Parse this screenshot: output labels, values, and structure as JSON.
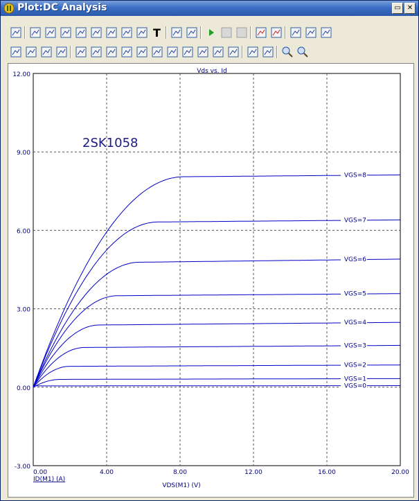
{
  "window": {
    "title": "Plot:DC Analysis"
  },
  "title_buttons": {
    "restore": "▭",
    "close": "✕"
  },
  "toolbar1": [
    "print-icon",
    "select-arrow-icon",
    "pan-dropdown-icon",
    "zoom-fit-icon",
    "grid-icon",
    "scale-icon",
    "cursor-icon",
    "peak-icon",
    "function-icon",
    "text-icon",
    "properties-icon",
    "settings-icon",
    "run-icon",
    "stop-icon",
    "pause-icon",
    "stepping-icon",
    "stepping-off-icon",
    "tile-icon",
    "tile-h-icon",
    "tile-v-icon"
  ],
  "toolbar2": [
    "x-axis-icon",
    "y-axis-icon",
    "zoom-axis-icon",
    "list-icon",
    "cursor-lines-icon",
    "cursor-peak-icon",
    "cursor-high-icon",
    "cursor-low-icon",
    "cursor-max-icon",
    "cursor-min-icon",
    "cursor-slope-icon",
    "cursor-next-icon",
    "cursor-prev-icon",
    "cursor-inflection-icon",
    "cursor-all-icon",
    "fit-icon",
    "fit-box-icon",
    "zoom-in-icon",
    "zoom-out-icon"
  ],
  "chart_data": {
    "type": "line",
    "title": "Vds vs. Id",
    "annotation": "2SK1058",
    "xlabel": "VDS(M1) (V)",
    "ylabel": "ID(M1) (A)",
    "xlim": [
      0,
      20
    ],
    "ylim": [
      -3,
      12
    ],
    "xticks": [
      0,
      4,
      8,
      12,
      16,
      20
    ],
    "yticks": [
      -3,
      0,
      3,
      6,
      9,
      12
    ],
    "xtick_labels": [
      "0.00",
      "4.00",
      "8.00",
      "12.00",
      "16.00",
      "20.00"
    ],
    "ytick_labels": [
      "-3.00",
      "0.00",
      "3.00",
      "6.00",
      "9.00",
      "12.00"
    ],
    "grid": true,
    "line_color": "#0000c8",
    "series": [
      {
        "name": "VGS=0",
        "vsat": 0.1,
        "isat": 0.05,
        "iend": 0.06
      },
      {
        "name": "VGS=1",
        "vsat": 1.5,
        "isat": 0.3,
        "iend": 0.33
      },
      {
        "name": "VGS=2",
        "vsat": 2.0,
        "isat": 0.8,
        "iend": 0.85
      },
      {
        "name": "VGS=3",
        "vsat": 2.8,
        "isat": 1.52,
        "iend": 1.6
      },
      {
        "name": "VGS=4",
        "vsat": 3.6,
        "isat": 2.38,
        "iend": 2.48
      },
      {
        "name": "VGS=5",
        "vsat": 4.6,
        "isat": 3.5,
        "iend": 3.58
      },
      {
        "name": "VGS=6",
        "vsat": 5.8,
        "isat": 4.78,
        "iend": 4.9
      },
      {
        "name": "VGS=7",
        "vsat": 6.8,
        "isat": 6.32,
        "iend": 6.4
      },
      {
        "name": "VGS=8",
        "vsat": 8.2,
        "isat": 8.05,
        "iend": 8.12
      }
    ]
  }
}
